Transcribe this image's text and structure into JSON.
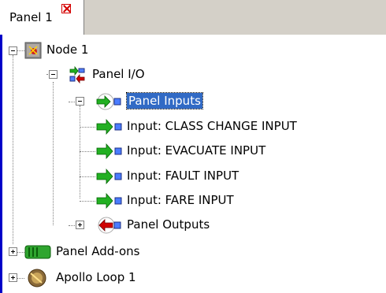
{
  "tab": {
    "label": "Panel 1"
  },
  "tree": {
    "node1": "Node 1",
    "panel_io": "Panel I/O",
    "panel_inputs": "Panel Inputs",
    "inputs": [
      "Input: CLASS CHANGE INPUT",
      "Input: EVACUATE INPUT",
      "Input: FAULT INPUT",
      "Input: FARE INPUT"
    ],
    "panel_outputs": "Panel Outputs",
    "panel_addons": "Panel Add-ons",
    "apollo_loop": "Apollo Loop 1"
  },
  "colors": {
    "selection": "#316ac5",
    "input_arrow": "#22b022",
    "output_arrow": "#d00000",
    "panel_border": "#0000c8"
  }
}
